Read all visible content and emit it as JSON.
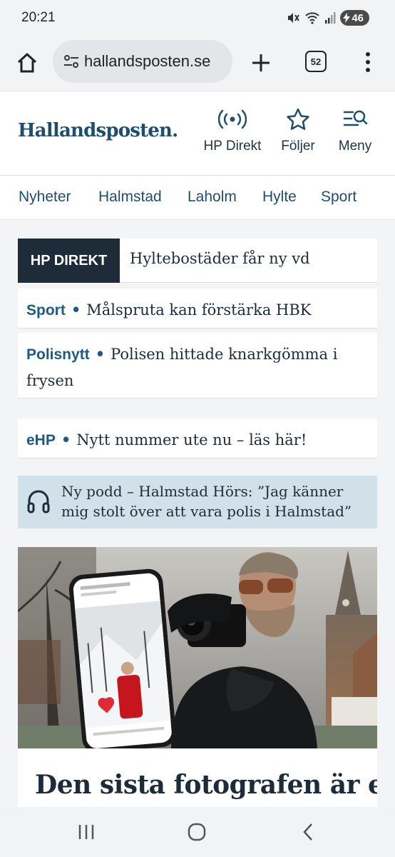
{
  "status_bar": {
    "time": "20:21",
    "battery": "46",
    "icons": [
      "mute-icon",
      "wifi-icon",
      "signal-icon",
      "battery-charging-icon"
    ]
  },
  "browser": {
    "url": "hallandsposten.se",
    "tab_count": "52",
    "icons": [
      "home-icon",
      "site-settings-icon",
      "new-tab-icon",
      "tabs-icon",
      "more-menu-icon"
    ]
  },
  "site_header": {
    "logo": "Hallandsposten.",
    "nav": [
      {
        "label": "HP Direkt",
        "icon": "live-broadcast-icon"
      },
      {
        "label": "Följer",
        "icon": "star-icon"
      },
      {
        "label": "Meny",
        "icon": "menu-search-icon"
      }
    ]
  },
  "sections": [
    "Nyheter",
    "Halmstad",
    "Laholm",
    "Hylte",
    "Sport"
  ],
  "hp_direkt": {
    "label": "HP DIREKT",
    "text": "Hyltebostäder får ny vd"
  },
  "news": [
    {
      "tag": "Sport",
      "text": "Målspruta kan förstärka HBK"
    },
    {
      "tag": "Polisnytt",
      "text": "Polisen hittade knarkgömma i frysen"
    },
    {
      "tag": "eHP",
      "text": "Nytt nummer ute nu – läs här!"
    }
  ],
  "podcast": {
    "icon": "headphones-icon",
    "text": "Ny podd – Halmstad Hörs: ”Jag känner mig stolt över att vara polis i Halmstad”"
  },
  "article": {
    "headline": "Den sista fotografen är en"
  },
  "colors": {
    "brand": "#1d4e6e",
    "accent": "#1d5b86",
    "dark": "#1e2b38",
    "podcast_bg": "#d2e1e9"
  }
}
